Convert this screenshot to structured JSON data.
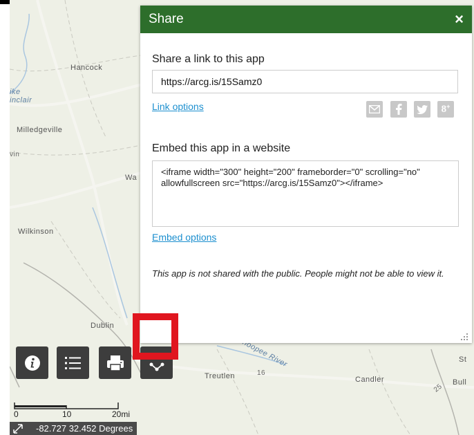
{
  "map": {
    "labels": {
      "hancock": "Hancock",
      "ike": "ike",
      "sinclair": "inclair",
      "milledgeville": "Milledgeville",
      "ivin": "vin",
      "wa": "Wa",
      "wilkinson": "Wilkinson",
      "dublin": "Dublin",
      "ohoopee": "Ohoopee River",
      "treutlen": "Treutlen",
      "route_16": "16",
      "candler": "Candler",
      "route_25": "25",
      "st": "St",
      "bull": "Bull"
    },
    "scale": {
      "zero": "0",
      "ten": "10",
      "twenty": "20mi"
    },
    "coordinates": "-82.727 32.452 Degrees"
  },
  "share": {
    "title": "Share",
    "close_symbol": "×",
    "link_section_title": "Share a link to this app",
    "link_value": "https://arcg.is/15Samz0",
    "link_options": "Link options",
    "social_icons": [
      "email-icon",
      "facebook-icon",
      "twitter-icon",
      "google-plus-icon"
    ],
    "embed_section_title": "Embed this app in a website",
    "embed_code": "<iframe width=\"300\" height=\"200\" frameborder=\"0\" scrolling=\"no\" allowfullscreen src=\"https://arcg.is/15Samz0\"></iframe>",
    "embed_options": "Embed options",
    "notice": "This app is not shared with the public. People might not be able to view it."
  },
  "toolbar": {
    "icons": [
      "info-icon",
      "legend-list-icon",
      "print-icon",
      "share-icon"
    ]
  },
  "colors": {
    "header": "#2d6e2b",
    "link": "#1c8fcf",
    "toolbar": "#3d3d3d",
    "highlight": "#e0161f"
  }
}
